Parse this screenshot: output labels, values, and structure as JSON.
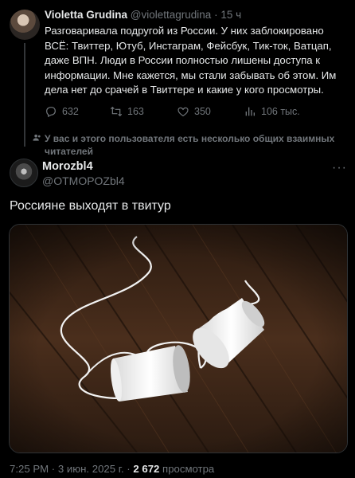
{
  "quoted_tweet": {
    "author_name": "Violetta Grudina",
    "author_handle": "@violettagrudina",
    "separator": "·",
    "time": "15 ч",
    "text": "Разговаривала подругой из России. У них заблокировано ВСЁ: Твиттер, Ютуб, Инстаграм, Фейсбук, Тик-ток, Ватцап, даже ВПН. Люди в России полностью лишены доступа к информации. Мне кажется, мы стали забывать об этом. Им дела нет до срачей в Твиттере и какие у кого просмотры.",
    "metrics": {
      "replies": "632",
      "reposts": "163",
      "likes": "350",
      "views": "106 тыс."
    },
    "mutual_notice": "У вас и этого пользователя есть несколько общих взаимных читателей"
  },
  "tweet": {
    "author_name": "Morozbl4",
    "author_handle": "@OTMOPOZbl4",
    "more_label": "···",
    "text": "Россияне выходят в твитур",
    "image_alt": "Two white paper cups connected by string on a wooden floor",
    "time": "7:25 PM",
    "date": "3 июн. 2025 г.",
    "views_count": "2 672",
    "views_label": "просмотра"
  },
  "icons": {
    "reply": "reply-icon",
    "repost": "repost-icon",
    "like": "like-icon",
    "views": "views-icon",
    "notice": "people-icon",
    "more": "more-icon"
  },
  "colors": {
    "background": "#000000",
    "text_primary": "#e7e9ea",
    "text_secondary": "#71767b",
    "border": "#2f3336"
  }
}
